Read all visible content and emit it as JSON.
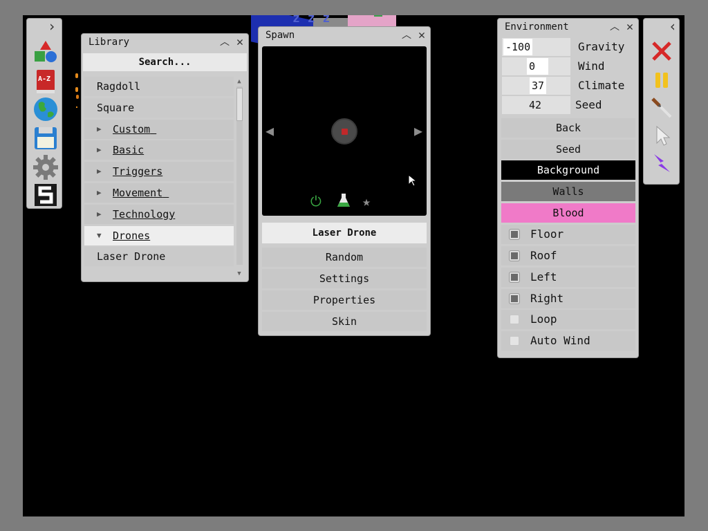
{
  "left_toolbar": {
    "collapse_glyph": "›",
    "tools": [
      {
        "name": "shapes-icon"
      },
      {
        "name": "catalog-book-icon",
        "text": "A-Z"
      },
      {
        "name": "globe-icon"
      },
      {
        "name": "save-disk-icon"
      },
      {
        "name": "gear-icon"
      },
      {
        "name": "script-s-icon",
        "text": "S"
      }
    ]
  },
  "library": {
    "title": "Library",
    "search_placeholder": "Search...",
    "items": [
      {
        "label": "Ragdoll",
        "type": "item"
      },
      {
        "label": "Square",
        "type": "item"
      },
      {
        "label": "Custom",
        "type": "folder"
      },
      {
        "label": "Basic",
        "type": "folder"
      },
      {
        "label": "Triggers",
        "type": "folder"
      },
      {
        "label": "Movement",
        "type": "folder"
      },
      {
        "label": "Technology",
        "type": "folder"
      },
      {
        "label": "Drones",
        "type": "folder-open"
      },
      {
        "label": "Laser Drone",
        "type": "item"
      }
    ]
  },
  "spawn": {
    "title": "Spawn",
    "selected_name": "Laser Drone",
    "buttons": [
      "Random",
      "Settings",
      "Properties",
      "Skin"
    ],
    "icons": [
      "power-icon",
      "flask-icon",
      "star-icon"
    ]
  },
  "environment": {
    "title": "Environment",
    "fields": [
      {
        "value": "-100",
        "label": "Gravity"
      },
      {
        "value": "0",
        "label": "Wind"
      },
      {
        "value": "37",
        "label": "Climate"
      },
      {
        "value": "42",
        "label": "Seed"
      }
    ],
    "buttons": [
      {
        "label": "Back",
        "style": "normal"
      },
      {
        "label": "Seed",
        "style": "normal"
      },
      {
        "label": "Background",
        "style": "black"
      },
      {
        "label": "Walls",
        "style": "gray"
      },
      {
        "label": "Blood",
        "style": "pink"
      }
    ],
    "toggles": [
      {
        "label": "Floor",
        "checked": true
      },
      {
        "label": "Roof",
        "checked": true
      },
      {
        "label": "Left",
        "checked": true
      },
      {
        "label": "Right",
        "checked": true
      },
      {
        "label": "Loop",
        "checked": false
      },
      {
        "label": "Auto Wind",
        "checked": false
      }
    ]
  },
  "right_toolbar": {
    "collapse_glyph": "‹",
    "tools": [
      "close-x-icon",
      "pause-icon",
      "knife-icon",
      "cursor-icon",
      "lightning-icon"
    ]
  },
  "colors": {
    "background_button": "#000000",
    "walls_button": "#7a7a7a",
    "blood_button": "#f07ac8",
    "frame": "#7d7d7d"
  }
}
